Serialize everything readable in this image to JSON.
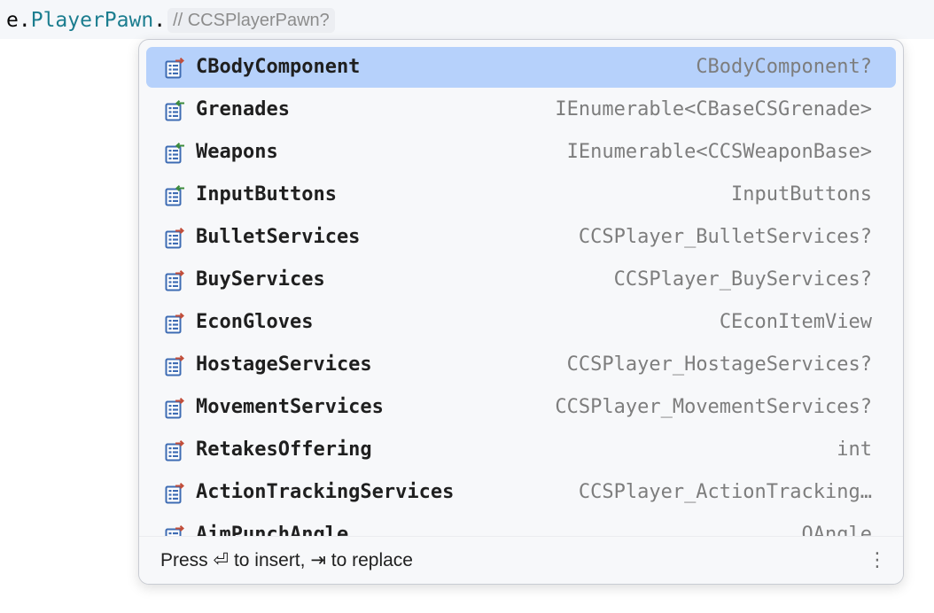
{
  "editor": {
    "receiver": "e",
    "dot": ".",
    "property": "PlayerPawn",
    "trailing_dot": ".",
    "inlay_hint": "// CCSPlayerPawn?"
  },
  "completion": {
    "items": [
      {
        "name": "CBodyComponent",
        "type": "CBodyComponent?",
        "icon": "property-icon",
        "selected": true
      },
      {
        "name": "Grenades",
        "type": "IEnumerable<CBaseCSGrenade>",
        "icon": "property-getter-icon",
        "selected": false
      },
      {
        "name": "Weapons",
        "type": "IEnumerable<CCSWeaponBase>",
        "icon": "property-getter-icon",
        "selected": false
      },
      {
        "name": "InputButtons",
        "type": "InputButtons",
        "icon": "property-getter-icon",
        "selected": false
      },
      {
        "name": "BulletServices",
        "type": "CCSPlayer_BulletServices?",
        "icon": "property-icon",
        "selected": false
      },
      {
        "name": "BuyServices",
        "type": "CCSPlayer_BuyServices?",
        "icon": "property-icon",
        "selected": false
      },
      {
        "name": "EconGloves",
        "type": "CEconItemView",
        "icon": "property-icon",
        "selected": false
      },
      {
        "name": "HostageServices",
        "type": "CCSPlayer_HostageServices?",
        "icon": "property-icon",
        "selected": false
      },
      {
        "name": "MovementServices",
        "type": "CCSPlayer_MovementServices?",
        "icon": "property-icon",
        "selected": false
      },
      {
        "name": "RetakesOffering",
        "type": "int",
        "icon": "property-icon",
        "selected": false
      },
      {
        "name": "ActionTrackingServices",
        "type": "CCSPlayer_ActionTracking…",
        "icon": "property-icon",
        "selected": false
      },
      {
        "name": "AimPunchAngle",
        "type": "QAngle",
        "icon": "property-icon",
        "selected": false
      }
    ],
    "footer": {
      "hint": "Press ⏎ to insert, ⇥ to replace",
      "more_icon": "⋮"
    }
  },
  "colors": {
    "selection": "#b6d1fb",
    "property_name": "#1b7d8f",
    "icon_blue": "#3d6bb3",
    "arrow_green": "#3c8b3c",
    "arrow_red": "#c24e3a"
  }
}
